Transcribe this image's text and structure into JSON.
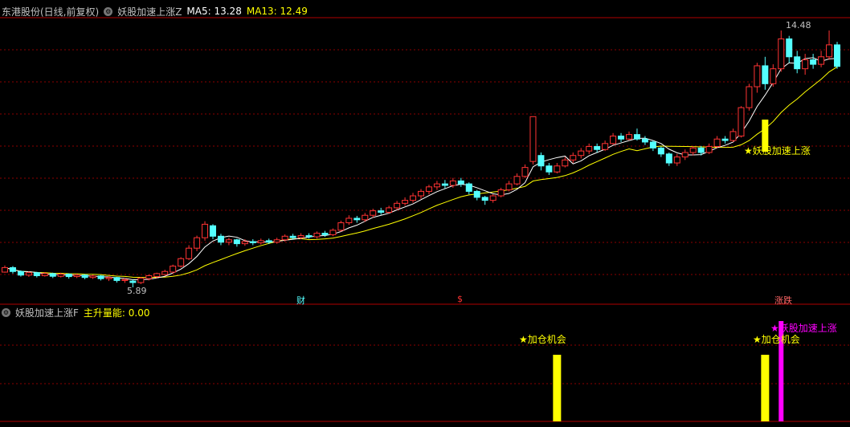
{
  "main_panel": {
    "title": "东港股份(日线,前复权)",
    "indicator_name": "妖股加速上涨Z",
    "ma5_label": "MA5: 13.28",
    "ma13_label": "MA13: 12.49",
    "high_label": "14.48",
    "low_label": "5.89",
    "signal_label": "★妖股加速上涨",
    "markers": {
      "cai": "财",
      "dollar": "$",
      "zhangdie": "涨跌"
    }
  },
  "sub_panel": {
    "title": "妖股加速上涨F",
    "power_label": "主升量能: 0.00",
    "opportunity_label_1": "★加仓机会",
    "opportunity_label_2": "★加仓机会",
    "signal_label": "★妖股加速上涨"
  },
  "colors": {
    "background": "#000000",
    "grid": "#8b0000",
    "up_candle": "#ff3333",
    "down_candle": "#54ffff",
    "ma5": "#ffffff",
    "ma13": "#ffff00",
    "signal_yellow": "#ffff00",
    "signal_magenta": "#ff00ff",
    "text_white": "#c0c0c0",
    "text_yellow": "#ffff00"
  },
  "chart_data": {
    "type": "candlestick",
    "y_high": 14.48,
    "y_low": 5.89,
    "candles": [
      {
        "o": 6.4,
        "c": 6.55,
        "h": 6.62,
        "l": 6.38
      },
      {
        "o": 6.55,
        "c": 6.42,
        "h": 6.6,
        "l": 6.35
      },
      {
        "o": 6.42,
        "c": 6.3,
        "h": 6.46,
        "l": 6.25
      },
      {
        "o": 6.3,
        "c": 6.38,
        "h": 6.42,
        "l": 6.24
      },
      {
        "o": 6.38,
        "c": 6.28,
        "h": 6.41,
        "l": 6.22
      },
      {
        "o": 6.28,
        "c": 6.35,
        "h": 6.4,
        "l": 6.25
      },
      {
        "o": 6.35,
        "c": 6.26,
        "h": 6.38,
        "l": 6.2
      },
      {
        "o": 6.26,
        "c": 6.33,
        "h": 6.38,
        "l": 6.22
      },
      {
        "o": 6.33,
        "c": 6.25,
        "h": 6.36,
        "l": 6.18
      },
      {
        "o": 6.25,
        "c": 6.3,
        "h": 6.35,
        "l": 6.2
      },
      {
        "o": 6.3,
        "c": 6.22,
        "h": 6.33,
        "l": 6.16
      },
      {
        "o": 6.22,
        "c": 6.27,
        "h": 6.31,
        "l": 6.17
      },
      {
        "o": 6.27,
        "c": 6.18,
        "h": 6.3,
        "l": 6.12
      },
      {
        "o": 6.18,
        "c": 6.22,
        "h": 6.26,
        "l": 6.1
      },
      {
        "o": 6.22,
        "c": 6.12,
        "h": 6.24,
        "l": 6.05
      },
      {
        "o": 6.12,
        "c": 6.15,
        "h": 6.2,
        "l": 6.04
      },
      {
        "o": 6.1,
        "c": 6.05,
        "h": 6.15,
        "l": 5.89
      },
      {
        "o": 6.05,
        "c": 6.2,
        "h": 6.24,
        "l": 6.0
      },
      {
        "o": 6.18,
        "c": 6.28,
        "h": 6.32,
        "l": 6.12
      },
      {
        "o": 6.25,
        "c": 6.35,
        "h": 6.38,
        "l": 6.2
      },
      {
        "o": 6.32,
        "c": 6.42,
        "h": 6.48,
        "l": 6.28
      },
      {
        "o": 6.4,
        "c": 6.6,
        "h": 6.65,
        "l": 6.36
      },
      {
        "o": 6.6,
        "c": 6.85,
        "h": 6.9,
        "l": 6.55
      },
      {
        "o": 6.85,
        "c": 7.2,
        "h": 7.3,
        "l": 6.8
      },
      {
        "o": 7.2,
        "c": 7.55,
        "h": 7.62,
        "l": 7.1
      },
      {
        "o": 7.55,
        "c": 8.0,
        "h": 8.1,
        "l": 7.45
      },
      {
        "o": 7.95,
        "c": 7.6,
        "h": 8.0,
        "l": 7.5
      },
      {
        "o": 7.6,
        "c": 7.4,
        "h": 7.68,
        "l": 7.3
      },
      {
        "o": 7.4,
        "c": 7.48,
        "h": 7.55,
        "l": 7.3
      },
      {
        "o": 7.48,
        "c": 7.35,
        "h": 7.52,
        "l": 7.25
      },
      {
        "o": 7.35,
        "c": 7.42,
        "h": 7.5,
        "l": 7.28
      },
      {
        "o": 7.42,
        "c": 7.38,
        "h": 7.5,
        "l": 7.3
      },
      {
        "o": 7.38,
        "c": 7.45,
        "h": 7.52,
        "l": 7.32
      },
      {
        "o": 7.45,
        "c": 7.4,
        "h": 7.52,
        "l": 7.34
      },
      {
        "o": 7.4,
        "c": 7.48,
        "h": 7.55,
        "l": 7.35
      },
      {
        "o": 7.48,
        "c": 7.6,
        "h": 7.66,
        "l": 7.42
      },
      {
        "o": 7.6,
        "c": 7.55,
        "h": 7.68,
        "l": 7.48
      },
      {
        "o": 7.55,
        "c": 7.62,
        "h": 7.7,
        "l": 7.5
      },
      {
        "o": 7.62,
        "c": 7.58,
        "h": 7.7,
        "l": 7.52
      },
      {
        "o": 7.58,
        "c": 7.7,
        "h": 7.76,
        "l": 7.52
      },
      {
        "o": 7.7,
        "c": 7.65,
        "h": 7.78,
        "l": 7.58
      },
      {
        "o": 7.65,
        "c": 7.8,
        "h": 7.86,
        "l": 7.6
      },
      {
        "o": 7.8,
        "c": 8.05,
        "h": 8.12,
        "l": 7.75
      },
      {
        "o": 8.05,
        "c": 8.2,
        "h": 8.3,
        "l": 7.98
      },
      {
        "o": 8.2,
        "c": 8.15,
        "h": 8.28,
        "l": 8.05
      },
      {
        "o": 8.15,
        "c": 8.3,
        "h": 8.38,
        "l": 8.08
      },
      {
        "o": 8.3,
        "c": 8.45,
        "h": 8.52,
        "l": 8.22
      },
      {
        "o": 8.45,
        "c": 8.4,
        "h": 8.55,
        "l": 8.32
      },
      {
        "o": 8.4,
        "c": 8.55,
        "h": 8.62,
        "l": 8.35
      },
      {
        "o": 8.55,
        "c": 8.7,
        "h": 8.78,
        "l": 8.48
      },
      {
        "o": 8.7,
        "c": 8.8,
        "h": 8.9,
        "l": 8.62
      },
      {
        "o": 8.8,
        "c": 8.95,
        "h": 9.05,
        "l": 8.72
      },
      {
        "o": 8.95,
        "c": 9.1,
        "h": 9.18,
        "l": 8.85
      },
      {
        "o": 9.1,
        "c": 9.25,
        "h": 9.32,
        "l": 9.0
      },
      {
        "o": 9.25,
        "c": 9.35,
        "h": 9.45,
        "l": 9.15
      },
      {
        "o": 9.35,
        "c": 9.3,
        "h": 9.48,
        "l": 9.2
      },
      {
        "o": 9.3,
        "c": 9.45,
        "h": 9.55,
        "l": 9.22
      },
      {
        "o": 9.45,
        "c": 9.35,
        "h": 9.55,
        "l": 9.25
      },
      {
        "o": 9.35,
        "c": 9.1,
        "h": 9.4,
        "l": 9.0
      },
      {
        "o": 9.1,
        "c": 8.9,
        "h": 9.15,
        "l": 8.8
      },
      {
        "o": 8.9,
        "c": 8.8,
        "h": 8.95,
        "l": 8.65
      },
      {
        "o": 8.8,
        "c": 8.95,
        "h": 9.0,
        "l": 8.72
      },
      {
        "o": 8.95,
        "c": 9.15,
        "h": 9.22,
        "l": 8.9
      },
      {
        "o": 9.15,
        "c": 9.35,
        "h": 9.45,
        "l": 9.1
      },
      {
        "o": 9.35,
        "c": 9.6,
        "h": 9.7,
        "l": 9.3
      },
      {
        "o": 9.6,
        "c": 9.9,
        "h": 10.0,
        "l": 9.55
      },
      {
        "o": 10.1,
        "c": 11.6,
        "h": 11.6,
        "l": 10.0
      },
      {
        "o": 10.3,
        "c": 9.95,
        "h": 10.4,
        "l": 9.8
      },
      {
        "o": 9.95,
        "c": 9.75,
        "h": 10.05,
        "l": 9.65
      },
      {
        "o": 9.75,
        "c": 9.95,
        "h": 10.05,
        "l": 9.7
      },
      {
        "o": 9.95,
        "c": 10.15,
        "h": 10.25,
        "l": 9.9
      },
      {
        "o": 10.15,
        "c": 10.3,
        "h": 10.4,
        "l": 10.05
      },
      {
        "o": 10.3,
        "c": 10.45,
        "h": 10.55,
        "l": 10.2
      },
      {
        "o": 10.45,
        "c": 10.6,
        "h": 10.7,
        "l": 10.35
      },
      {
        "o": 10.6,
        "c": 10.5,
        "h": 10.7,
        "l": 10.4
      },
      {
        "o": 10.5,
        "c": 10.7,
        "h": 10.8,
        "l": 10.45
      },
      {
        "o": 10.7,
        "c": 10.95,
        "h": 11.05,
        "l": 10.65
      },
      {
        "o": 10.95,
        "c": 10.85,
        "h": 11.05,
        "l": 10.75
      },
      {
        "o": 10.85,
        "c": 11.0,
        "h": 11.1,
        "l": 10.8
      },
      {
        "o": 11.0,
        "c": 10.85,
        "h": 11.2,
        "l": 10.8
      },
      {
        "o": 10.85,
        "c": 10.75,
        "h": 10.95,
        "l": 10.65
      },
      {
        "o": 10.75,
        "c": 10.55,
        "h": 10.8,
        "l": 10.45
      },
      {
        "o": 10.55,
        "c": 10.35,
        "h": 10.6,
        "l": 10.25
      },
      {
        "o": 10.35,
        "c": 10.05,
        "h": 10.4,
        "l": 9.95
      },
      {
        "o": 10.05,
        "c": 10.25,
        "h": 10.35,
        "l": 9.95
      },
      {
        "o": 10.25,
        "c": 10.4,
        "h": 10.5,
        "l": 10.15
      },
      {
        "o": 10.4,
        "c": 10.55,
        "h": 10.62,
        "l": 10.3
      },
      {
        "o": 10.55,
        "c": 10.4,
        "h": 10.62,
        "l": 10.3
      },
      {
        "o": 10.4,
        "c": 10.6,
        "h": 10.7,
        "l": 10.35
      },
      {
        "o": 10.6,
        "c": 10.85,
        "h": 10.95,
        "l": 10.55
      },
      {
        "o": 10.85,
        "c": 10.8,
        "h": 10.95,
        "l": 10.7
      },
      {
        "o": 10.8,
        "c": 11.1,
        "h": 11.2,
        "l": 10.75
      },
      {
        "o": 10.95,
        "c": 11.9,
        "h": 11.95,
        "l": 10.9
      },
      {
        "o": 11.9,
        "c": 12.6,
        "h": 12.7,
        "l": 11.8
      },
      {
        "o": 12.6,
        "c": 13.3,
        "h": 13.4,
        "l": 12.4
      },
      {
        "o": 13.3,
        "c": 12.7,
        "h": 13.6,
        "l": 12.5
      },
      {
        "o": 12.7,
        "c": 13.2,
        "h": 13.35,
        "l": 12.6
      },
      {
        "o": 13.2,
        "c": 14.2,
        "h": 14.48,
        "l": 13.1
      },
      {
        "o": 14.2,
        "c": 13.6,
        "h": 14.3,
        "l": 13.4
      },
      {
        "o": 13.6,
        "c": 13.2,
        "h": 13.8,
        "l": 13.05
      },
      {
        "o": 13.2,
        "c": 13.5,
        "h": 13.7,
        "l": 13.0
      },
      {
        "o": 13.5,
        "c": 13.35,
        "h": 13.7,
        "l": 13.2
      },
      {
        "o": 13.35,
        "c": 13.6,
        "h": 13.8,
        "l": 13.25
      },
      {
        "o": 13.6,
        "c": 14.0,
        "h": 14.48,
        "l": 13.5
      },
      {
        "o": 14.0,
        "c": 13.28,
        "h": 14.1,
        "l": 13.2
      }
    ],
    "signals": [
      {
        "type": "opportunity",
        "index": 69
      },
      {
        "type": "opportunity",
        "index": 95
      },
      {
        "type": "accelerate",
        "index": 97
      }
    ]
  }
}
